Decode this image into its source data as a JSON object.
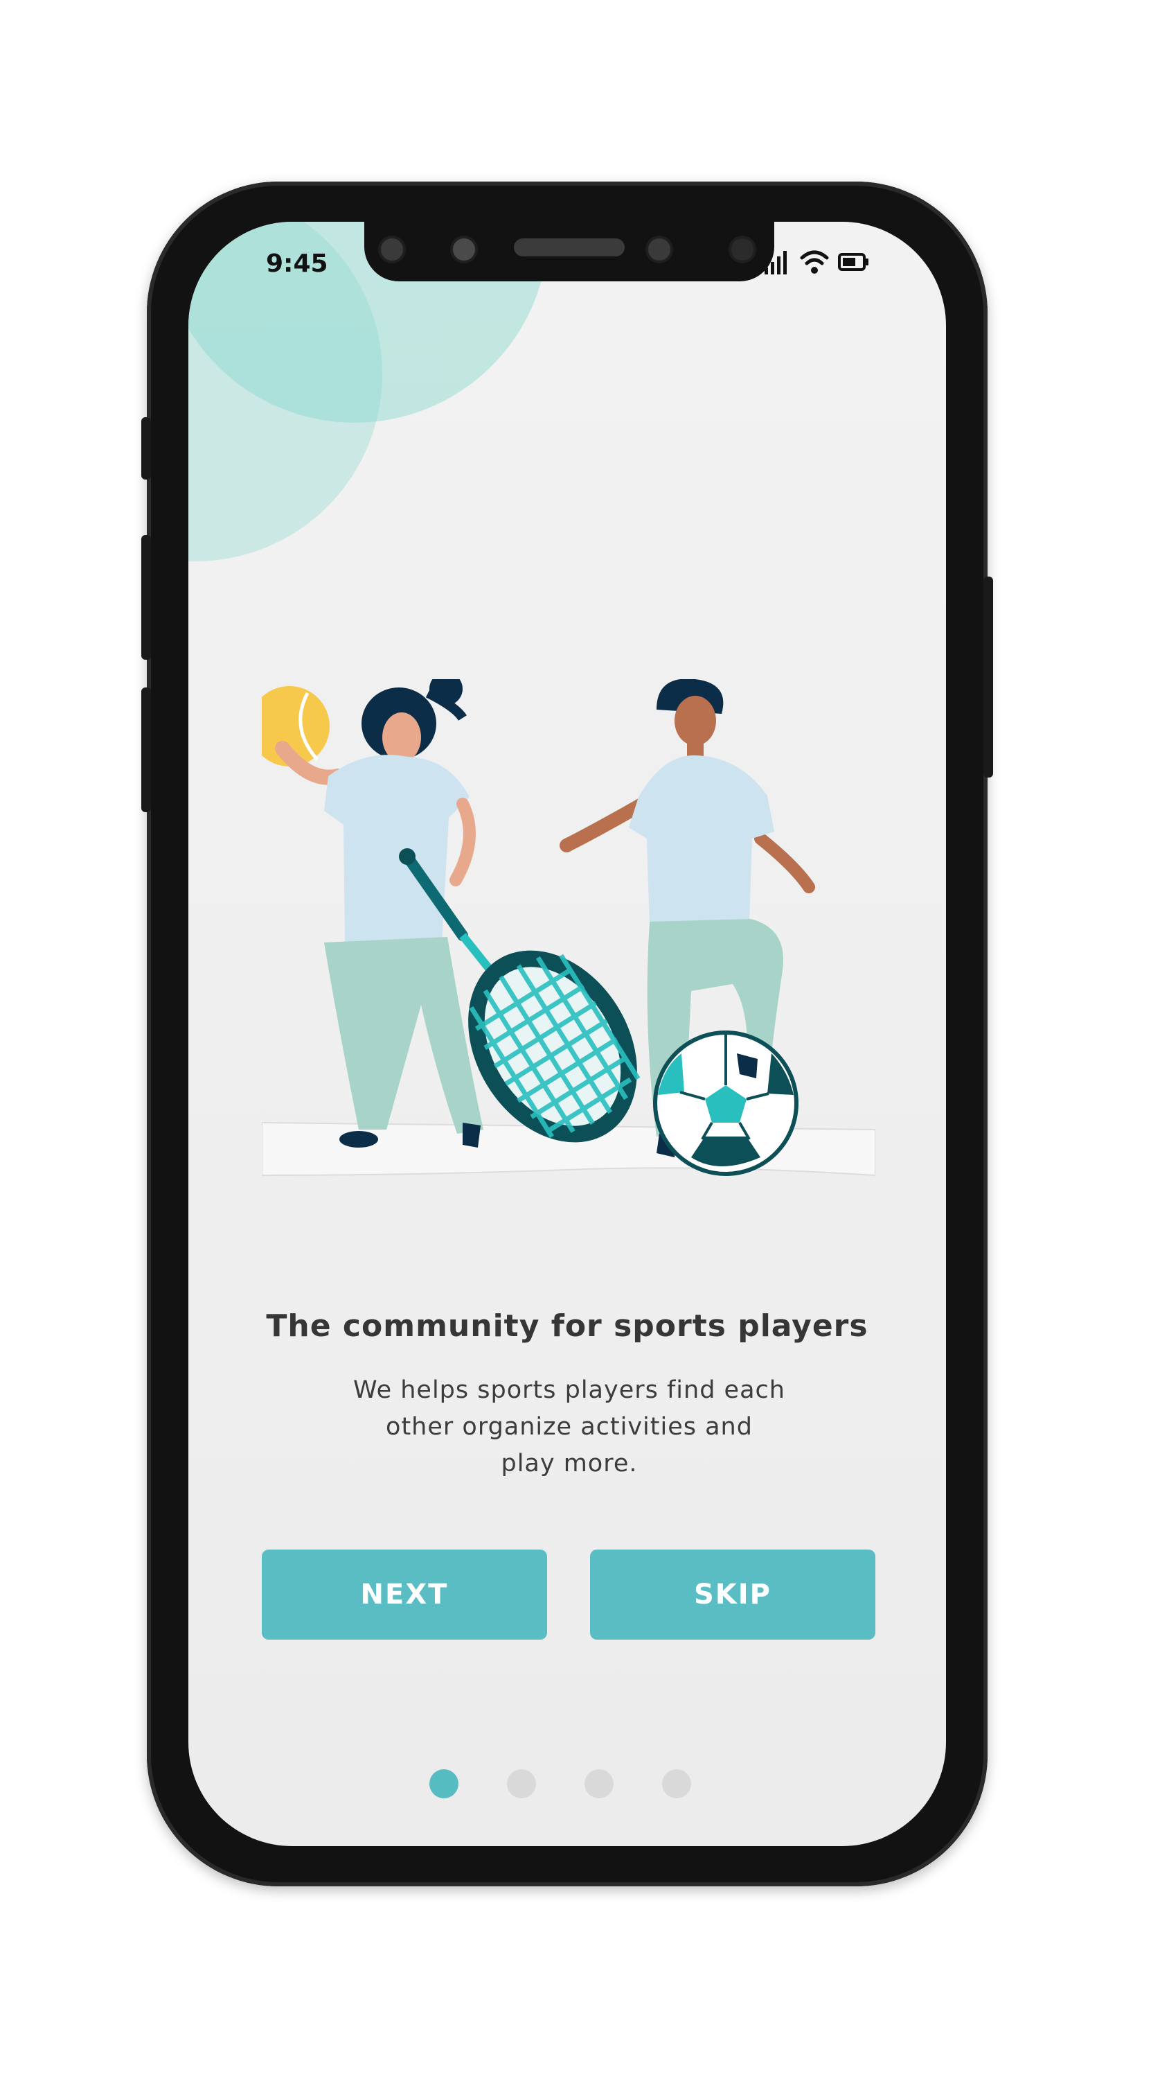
{
  "status_bar": {
    "time": "9:45",
    "icons": [
      "cellular-signal-icon",
      "wifi-icon",
      "battery-icon"
    ]
  },
  "onboarding": {
    "title": "The community for sports players",
    "description_lines": [
      "We helps sports players find each",
      "other organize activities and",
      "play more."
    ],
    "next_label": "NEXT",
    "skip_label": "SKIP",
    "page_indicator": {
      "total": 4,
      "active_index": 0
    }
  },
  "colors": {
    "accent": "#59bdc3",
    "dot_inactive": "#d9d9d9",
    "title_text": "#363636",
    "screen_bg": "#f0f0f0"
  },
  "illustration": {
    "subject": "two-players-tennis-and-soccer"
  }
}
